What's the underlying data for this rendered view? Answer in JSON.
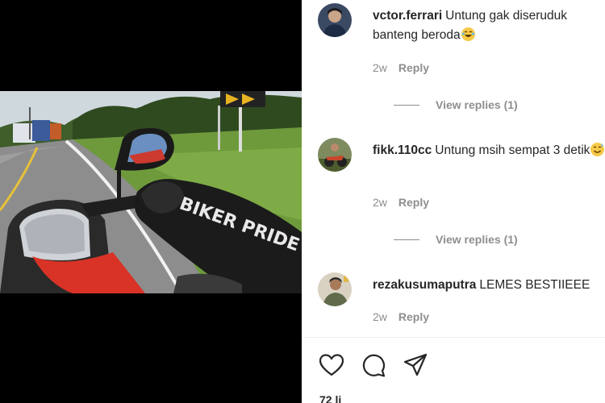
{
  "comments": [
    {
      "username": "vctor.ferrari",
      "text": "Untung gak diseruduk banteng beroda",
      "emoji": "laughing-emoji",
      "time": "2w",
      "reply_label": "Reply",
      "view_replies": "View replies (1)"
    },
    {
      "username": "fikk.110cc",
      "text": "Untung msih sempat 3 detik",
      "emoji": "smiling-sweat-emoji",
      "time": "2w",
      "reply_label": "Reply",
      "view_replies": "View replies (1)"
    },
    {
      "username": "rezakusumaputra",
      "text": "LEMES BESTIIEEE",
      "time": "2w",
      "reply_label": "Reply"
    }
  ],
  "actions": {
    "like_icon": "heart-icon",
    "comment_icon": "comment-icon",
    "share_icon": "send-icon"
  },
  "likes_text": "72 li",
  "video": {
    "jacket_text": "BIKER PRIDE"
  },
  "colors": {
    "text": "#262626",
    "muted": "#8e8e8e",
    "background": "#ffffff",
    "media_bg": "#000000"
  }
}
